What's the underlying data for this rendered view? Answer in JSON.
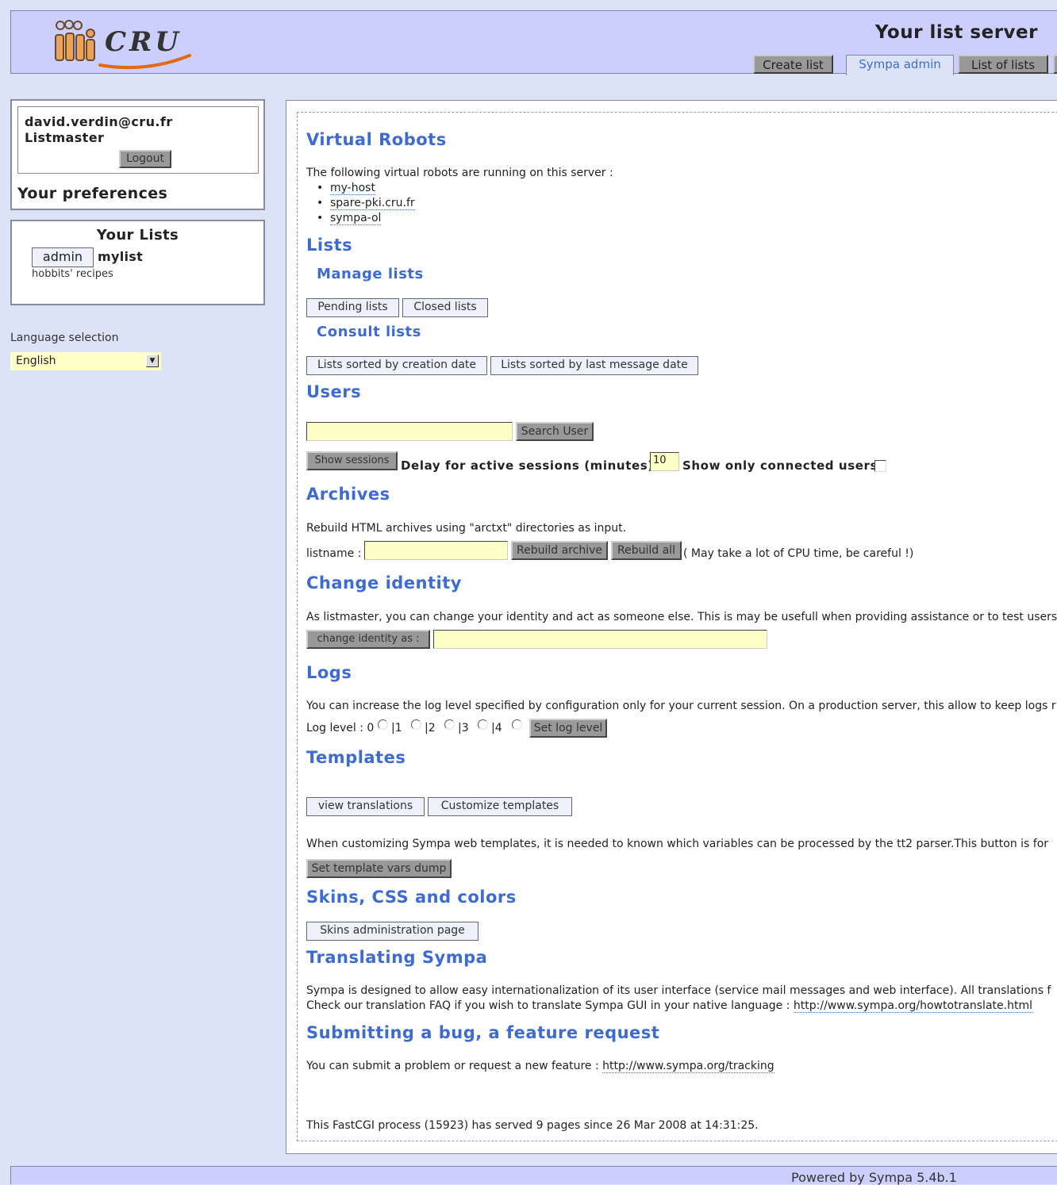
{
  "header": {
    "logo_text": "CRU",
    "title": "Your list server",
    "tabs": [
      {
        "label": "Create list"
      },
      {
        "label": "Sympa admin"
      },
      {
        "label": "List of lists"
      }
    ]
  },
  "user": {
    "email": "david.verdin@cru.fr",
    "role": "Listmaster",
    "logout_label": "Logout",
    "preferences_label": "Your preferences"
  },
  "your_lists": {
    "title": "Your Lists",
    "admin_button": "admin",
    "list_name": "mylist",
    "list_description": "hobbits' recipes"
  },
  "language": {
    "label": "Language selection",
    "selected": "English"
  },
  "main": {
    "virtual_robots": {
      "title": "Virtual Robots",
      "intro": "The following virtual robots are running on this server :",
      "robots": [
        "my-host",
        "spare-pki.cru.fr",
        "sympa-ol"
      ]
    },
    "lists": {
      "title": "Lists",
      "manage_title": "Manage lists",
      "pending_button": "Pending lists",
      "closed_button": "Closed lists",
      "consult_title": "Consult lists",
      "by_creation_button": "Lists sorted by creation date",
      "by_last_message_button": "Lists sorted by last message date"
    },
    "users": {
      "title": "Users",
      "search_value": "",
      "search_button": "Search User",
      "show_sessions_button": "Show sessions",
      "delay_label": "Delay for active sessions (minutes)",
      "delay_value": "10",
      "connected_label": "Show only connected users"
    },
    "archives": {
      "title": "Archives",
      "text": "Rebuild HTML archives using \"arctxt\" directories as input.",
      "listname_label": "listname :",
      "rebuild_button": "Rebuild archive",
      "rebuild_all_button": "Rebuild all",
      "warning": "( May take a lot of CPU time, be careful !)"
    },
    "change_identity": {
      "title": "Change identity",
      "text": "As listmaster, you can change your identity and act as someone else. This is may be usefull when providing assistance or to test users",
      "button": "change identity as :"
    },
    "logs": {
      "title": "Logs",
      "text": "You can increase the log level specified by configuration only for your current session. On a production server, this allow to keep logs r",
      "level_label": "Log level : ",
      "levels": [
        "0",
        "1",
        "2",
        "3",
        "4"
      ],
      "button": "Set log level"
    },
    "templates": {
      "title": "Templates",
      "view_translations_button": "view translations",
      "customize_button": "Customize templates",
      "text": "When customizing Sympa web templates, it is needed to known which variables can be processed by the tt2 parser.This button is for",
      "dump_button": "Set template vars dump"
    },
    "skins": {
      "title": "Skins, CSS and colors",
      "button": "Skins administration page"
    },
    "translating": {
      "title": "Translating Sympa",
      "text1": "Sympa is designed to allow easy internationalization of its user interface (service mail messages and web interface). All translations f",
      "text2": "Check our translation FAQ if you wish to translate Sympa GUI in your native language : ",
      "link": "http://www.sympa.org/howtotranslate.html"
    },
    "bug": {
      "title": "Submitting a bug, a feature request",
      "text": "You can submit a problem or request a new feature : ",
      "link": "http://www.sympa.org/tracking"
    },
    "fastcgi_status": "This FastCGI process (15923) has served 9 pages since 26 Mar 2008 at 14:31:25."
  },
  "footer": {
    "powered_by": "Powered by Sympa 5.4b.1"
  }
}
